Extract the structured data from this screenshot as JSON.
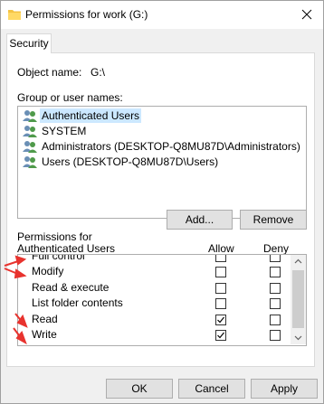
{
  "window": {
    "title": "Permissions for work (G:)",
    "close_glyph": "✕"
  },
  "tab": {
    "label": "Security"
  },
  "object": {
    "label": "Object name:",
    "value": "G:\\"
  },
  "groups": {
    "label": "Group or user names:",
    "items": [
      {
        "label": "Authenticated Users",
        "selected": true
      },
      {
        "label": "SYSTEM",
        "selected": false
      },
      {
        "label": "Administrators (DESKTOP-Q8MU87D\\Administrators)",
        "selected": false
      },
      {
        "label": "Users (DESKTOP-Q8MU87D\\Users)",
        "selected": false
      }
    ]
  },
  "buttons": {
    "add": "Add...",
    "remove": "Remove",
    "ok": "OK",
    "cancel": "Cancel",
    "apply": "Apply"
  },
  "permissions": {
    "label": "Permissions for Authenticated Users",
    "allow_header": "Allow",
    "deny_header": "Deny",
    "rows": [
      {
        "name": "Full control",
        "allow": false,
        "deny": false
      },
      {
        "name": "Modify",
        "allow": false,
        "deny": false
      },
      {
        "name": "Read & execute",
        "allow": false,
        "deny": false
      },
      {
        "name": "List folder contents",
        "allow": false,
        "deny": false
      },
      {
        "name": "Read",
        "allow": true,
        "deny": false
      },
      {
        "name": "Write",
        "allow": true,
        "deny": false
      }
    ]
  },
  "colors": {
    "annotation_arrow": "#e8332e",
    "selection": "#cce8ff",
    "folder": "#f4c343"
  },
  "icons": {
    "folder": "folder-icon",
    "users": "users-icon",
    "close": "close-icon"
  }
}
